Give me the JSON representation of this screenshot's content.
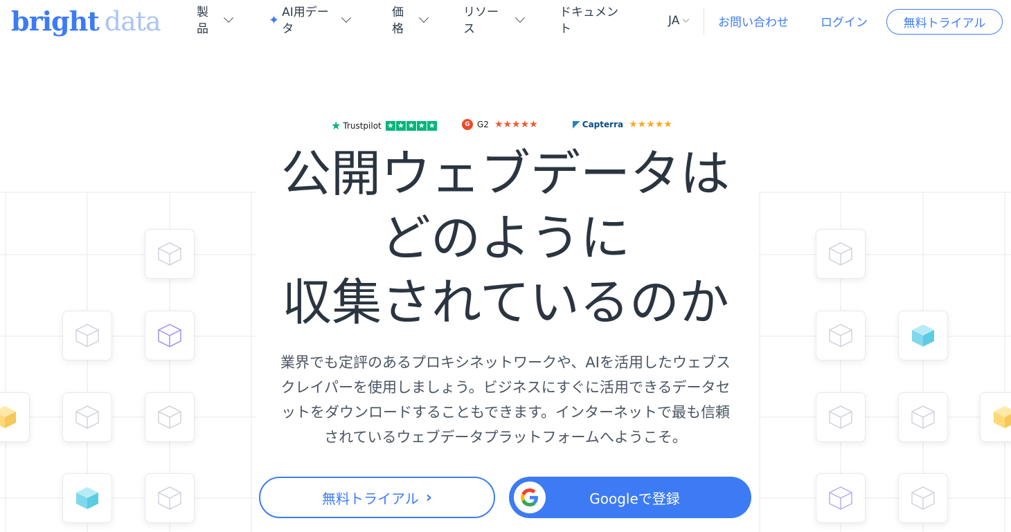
{
  "brand": {
    "name_part1": "bright",
    "name_part2": "data"
  },
  "nav": {
    "items": [
      {
        "label": "製\n品"
      },
      {
        "label": "AI用デー\nタ"
      },
      {
        "label": "価\n格"
      },
      {
        "label": "リソー\nス"
      },
      {
        "label": "ドキュメン\nト"
      }
    ],
    "lang": "JA",
    "contact": "お問い合わせ",
    "login": "ログイン",
    "trial": "無料トライアル"
  },
  "ratings": {
    "trustpilot": "Trustpilot",
    "g2": "G2",
    "capterra": "Capterra"
  },
  "hero": {
    "headline_lines": [
      "公開ウェブデータは",
      "どのように",
      "収集されているのか"
    ],
    "subtext_lines": [
      "業界でも定評のあるプロキシネットワークや、AIを活用したウェブス",
      "クレイパーを使用しましょう。ビジネスにすぐに活用できるデータセ",
      "ットをダウンロードすることもできます。インターネットで最も信頼",
      "されているウェブデータプラットフォームへようこそ。"
    ],
    "cta_trial": "無料トライアル",
    "cta_google": "Googleで登録"
  },
  "colors": {
    "accent": "#3d7bf5",
    "trustpilot": "#00b67a",
    "g2": "#ef492d",
    "capterra_star": "#f7a921",
    "cube_cyan": "#7fd8ec",
    "cube_yellow": "#ffd978",
    "cube_purple": "#a390f0"
  },
  "icons": [
    "chevron-down-icon",
    "sparkle-icon",
    "trustpilot-star-icon",
    "g2-logo-icon",
    "capterra-logo-icon",
    "cube-icon",
    "chevron-right-icon",
    "google-g-icon"
  ]
}
